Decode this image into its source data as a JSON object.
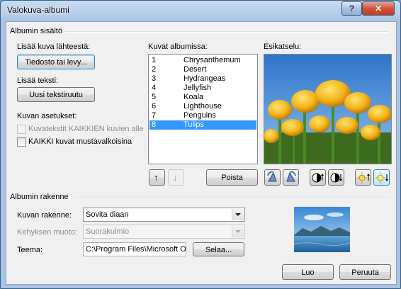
{
  "window": {
    "title": "Valokuva-albumi",
    "help_glyph": "?",
    "close_glyph": "✕"
  },
  "album_content": {
    "group_label": "Albumin sisältö",
    "insert_from": {
      "label": "Lisää kuva lähteestä:",
      "button": "Tiedosto tai levy..."
    },
    "insert_text": {
      "label": "Lisää teksti:",
      "button": "Uusi tekstiruutu"
    },
    "picture_options": {
      "label": "Kuvan asetukset:",
      "captions": {
        "label": "Kuvatekstit KAIKKIEN kuvien alle",
        "checked": false,
        "enabled": false
      },
      "black_white": {
        "label": "KAIKKI kuvat mustavalkoisina",
        "checked": false,
        "enabled": true
      }
    },
    "pictures_in_album": {
      "label": "Kuvat albumissa:",
      "items": [
        {
          "num": "1",
          "name": "Chrysanthemum",
          "selected": false
        },
        {
          "num": "2",
          "name": "Desert",
          "selected": false
        },
        {
          "num": "3",
          "name": "Hydrangeas",
          "selected": false
        },
        {
          "num": "4",
          "name": "Jellyfish",
          "selected": false
        },
        {
          "num": "5",
          "name": "Koala",
          "selected": false
        },
        {
          "num": "6",
          "name": "Lighthouse",
          "selected": false
        },
        {
          "num": "7",
          "name": "Penguins",
          "selected": false
        },
        {
          "num": "8",
          "name": "Tulips",
          "selected": true
        }
      ],
      "move_up_glyph": "↑",
      "move_down_glyph": "↓",
      "remove_button": "Poista"
    },
    "preview": {
      "label": "Esikatselu:",
      "tool_icons": [
        "rotate-left-icon",
        "rotate-right-icon",
        "contrast-increase-icon",
        "contrast-decrease-icon",
        "brightness-increase-icon",
        "brightness-decrease-icon"
      ]
    }
  },
  "album_layout": {
    "group_label": "Albumin rakenne",
    "picture_layout": {
      "label": "Kuvan rakenne:",
      "value": "Sovita diaan"
    },
    "frame_shape": {
      "label": "Kehyksen muoto:",
      "value": "Suorakulmio",
      "enabled": false
    },
    "theme": {
      "label": "Teema:",
      "value": "C:\\Program Files\\Microsoft Of",
      "browse_button": "Selaa..."
    }
  },
  "footer": {
    "create_button": "Luo",
    "cancel_button": "Peruuta"
  },
  "colors": {
    "selection": "#3399ff",
    "title_bar": "#a9c4e3",
    "close_button": "#c13d23"
  }
}
